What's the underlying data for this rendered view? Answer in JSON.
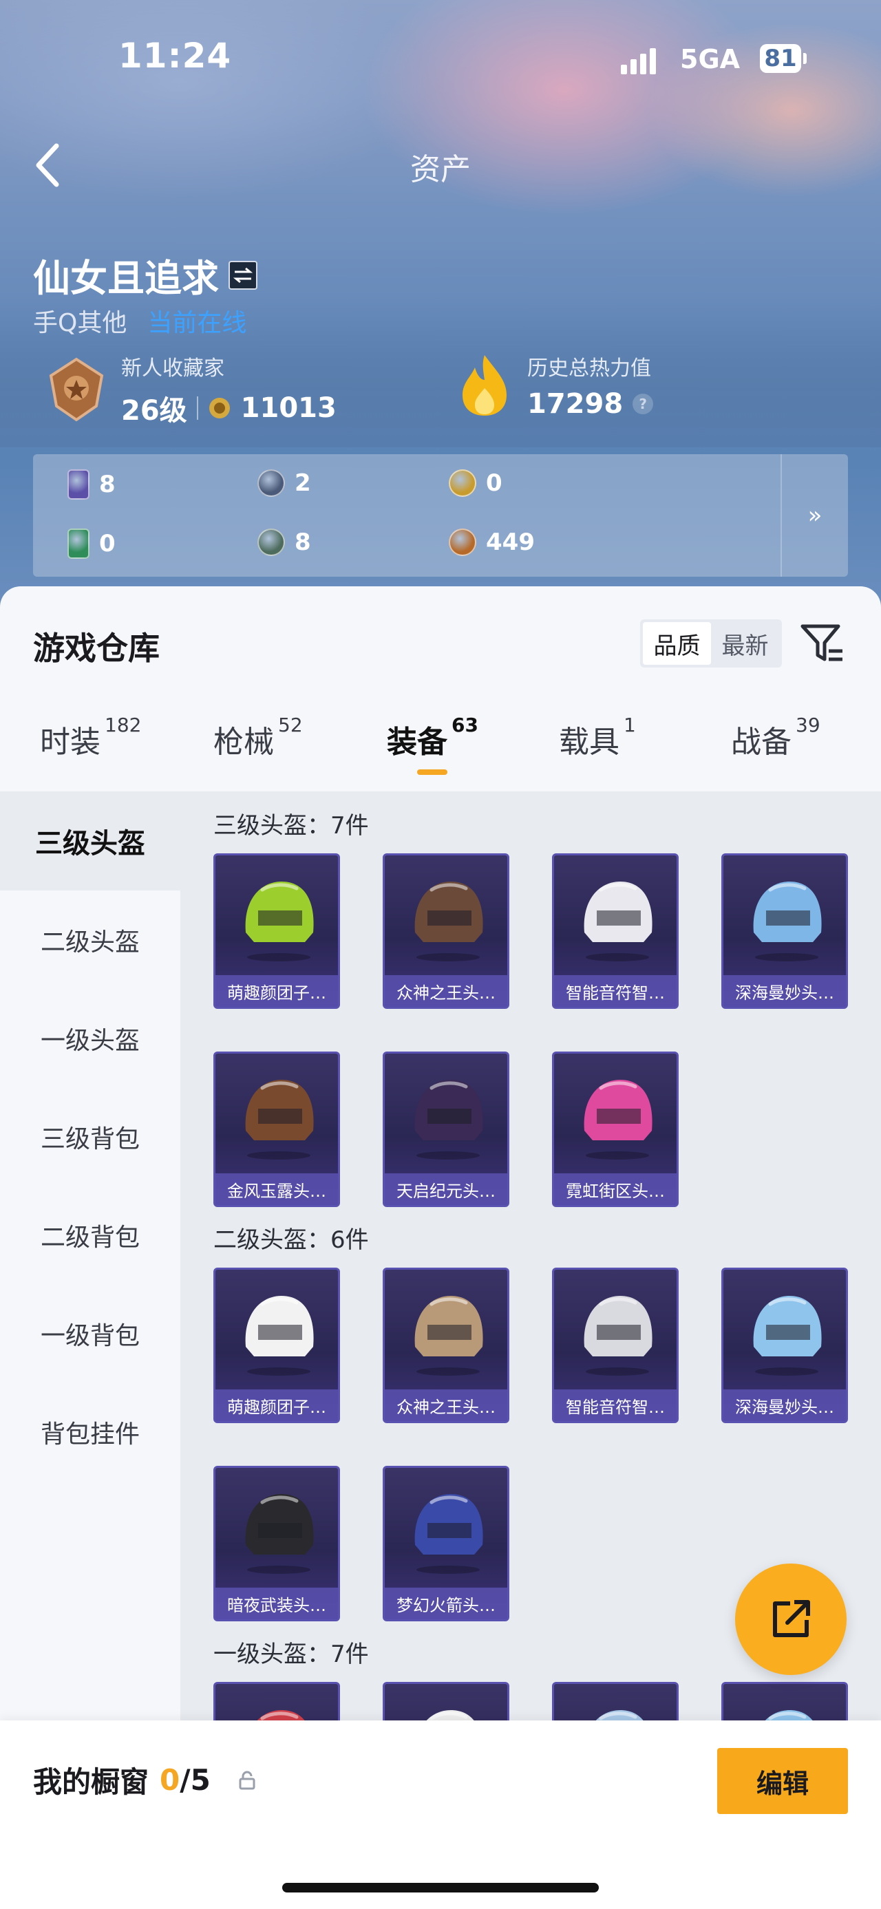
{
  "status_bar": {
    "time": "11:24",
    "network": "5GA",
    "battery": "81"
  },
  "nav": {
    "title": "资产"
  },
  "profile": {
    "name": "仙女且追求",
    "platform": "手Q其他",
    "online_status": "当前在线",
    "collector_title": "新人收藏家",
    "level": "26级",
    "points": "11013",
    "heat_label": "历史总热力值",
    "heat_value": "17298",
    "help": "?"
  },
  "currencies": [
    {
      "icon": "card-icon",
      "value": "8",
      "color": "#5b4fa8"
    },
    {
      "icon": "coin-ring-icon",
      "value": "2",
      "color": "#4a5a78"
    },
    {
      "icon": "gold-coin-icon",
      "value": "0",
      "color": "#c89b2e"
    },
    {
      "icon": "green-card-icon",
      "value": "0",
      "color": "#2f8d5a"
    },
    {
      "icon": "gem-icon",
      "value": "8",
      "color": "#4e6c5e"
    },
    {
      "icon": "bronze-coin-icon",
      "value": "449",
      "color": "#b56a2a"
    }
  ],
  "more_label": "»",
  "warehouse": {
    "title": "游戏仓库",
    "sort": {
      "quality": "品质",
      "newest": "最新"
    }
  },
  "tabs": [
    {
      "label": "时装",
      "count": "182"
    },
    {
      "label": "枪械",
      "count": "52"
    },
    {
      "label": "装备",
      "count": "63"
    },
    {
      "label": "载具",
      "count": "1"
    },
    {
      "label": "战备",
      "count": "39"
    }
  ],
  "sidebar": [
    {
      "label": "三级头盔"
    },
    {
      "label": "二级头盔"
    },
    {
      "label": "一级头盔"
    },
    {
      "label": "三级背包"
    },
    {
      "label": "二级背包"
    },
    {
      "label": "一级背包"
    },
    {
      "label": "背包挂件"
    }
  ],
  "groups": [
    {
      "title": "三级头盔：7件",
      "items": [
        {
          "name": "萌趣颜团子…",
          "icon": "helmet-icon",
          "color": "#9ccf2e"
        },
        {
          "name": "众神之王头…",
          "icon": "helmet-icon",
          "color": "#6b4a3a"
        },
        {
          "name": "智能音符智…",
          "icon": "helmet-icon",
          "color": "#e8e8ee"
        },
        {
          "name": "深海曼妙头…",
          "icon": "helmet-icon",
          "color": "#7fb6e8"
        },
        {
          "name": "金风玉露头…",
          "icon": "helmet-icon",
          "color": "#7a4a2e"
        },
        {
          "name": "天启纪元头…",
          "icon": "helmet-icon",
          "color": "#3a2a55"
        },
        {
          "name": "霓虹街区头…",
          "icon": "helmet-icon",
          "color": "#e04a9e"
        }
      ]
    },
    {
      "title": "二级头盔：6件",
      "items": [
        {
          "name": "萌趣颜团子…",
          "icon": "helmet-icon",
          "color": "#f2f2f2"
        },
        {
          "name": "众神之王头…",
          "icon": "helmet-icon",
          "color": "#b89a78"
        },
        {
          "name": "智能音符智…",
          "icon": "helmet-icon",
          "color": "#d9d9e0"
        },
        {
          "name": "深海曼妙头…",
          "icon": "helmet-icon",
          "color": "#8fc4ec"
        },
        {
          "name": "暗夜武装头…",
          "icon": "helmet-icon",
          "color": "#2a2a2e"
        },
        {
          "name": "梦幻火箭头…",
          "icon": "helmet-icon",
          "color": "#3a4aa8"
        }
      ]
    },
    {
      "title": "一级头盔：7件",
      "items": [
        {
          "name": "",
          "icon": "helmet-icon",
          "color": "#d0404a"
        },
        {
          "name": "",
          "icon": "helmet-icon",
          "color": "#eeeeee"
        },
        {
          "name": "",
          "icon": "helmet-icon",
          "color": "#a8c8e8"
        },
        {
          "name": "",
          "icon": "helmet-icon",
          "color": "#8fc4ec"
        }
      ]
    }
  ],
  "showcase": {
    "label": "我的橱窗",
    "count": "0",
    "total": "/5",
    "edit": "编辑"
  }
}
